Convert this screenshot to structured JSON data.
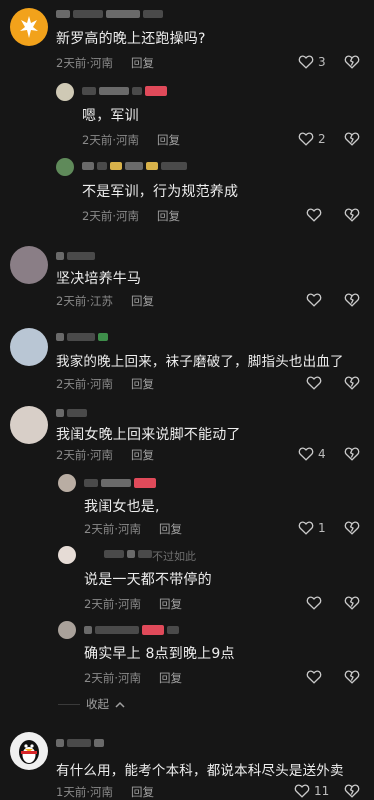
{
  "comments": [
    {
      "text": "新罗高的晚上还跑操吗?",
      "time": "2天前",
      "region": "河南",
      "reply": "回复",
      "likes": "3"
    },
    {
      "text": "嗯，军训",
      "time": "2天前",
      "region": "河南",
      "reply": "回复",
      "likes": "2"
    },
    {
      "text": "不是军训，行为规范养成",
      "time": "2天前",
      "region": "河南",
      "reply": "回复",
      "likes": ""
    },
    {
      "text": "坚决培养牛马",
      "time": "2天前",
      "region": "江苏",
      "reply": "回复",
      "likes": ""
    },
    {
      "text": "我家的晚上回来，袜子磨破了，脚指头也出血了",
      "time": "2天前",
      "region": "河南",
      "reply": "回复",
      "likes": ""
    },
    {
      "text": "我闺女晚上回来说脚不能动了",
      "time": "2天前",
      "region": "河南",
      "reply": "回复",
      "likes": "4"
    },
    {
      "text": "我闺女也是,",
      "time": "2天前",
      "region": "河南",
      "reply": "回复",
      "likes": "1"
    },
    {
      "text": "说是一天都不带停的",
      "time": "2天前",
      "region": "河南",
      "reply": "回复",
      "likes": "",
      "name_suffix": "不过如此"
    },
    {
      "text": "确实早上 8点到晚上9点",
      "time": "2天前",
      "region": "河南",
      "reply": "回复",
      "likes": ""
    },
    {
      "text": "有什么用，能考个本科，都说本科尽头是送外卖",
      "time": "1天前",
      "region": "河南",
      "reply": "回复",
      "likes": "11"
    }
  ],
  "collapse_label": "收起",
  "separator": "·",
  "icons": {
    "like": "heart-outline-icon",
    "dislike": "broken-heart-icon",
    "collapse": "chevron-up-icon"
  },
  "colors": {
    "background": "#161616",
    "text": "#ededed",
    "meta": "#8a8a8a",
    "logo": "#f2a21b"
  }
}
